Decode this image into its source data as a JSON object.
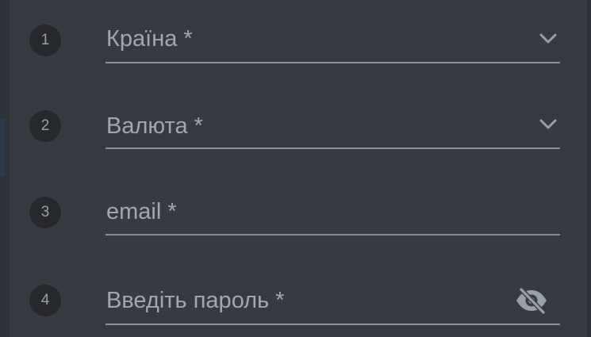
{
  "form": {
    "fields": [
      {
        "step": "1",
        "label": "Країна *",
        "type": "select",
        "icon": "chevron-down-icon"
      },
      {
        "step": "2",
        "label": "Валюта *",
        "type": "select",
        "icon": "chevron-down-icon"
      },
      {
        "step": "3",
        "label": "email *",
        "type": "text"
      },
      {
        "step": "4",
        "label": "Введіть пароль *",
        "type": "password",
        "icon": "eye-off-icon"
      }
    ]
  },
  "colors": {
    "background": "#363a41",
    "step_badge": "#26282e",
    "text": "#a3a8ae",
    "underline": "#8b9097"
  }
}
